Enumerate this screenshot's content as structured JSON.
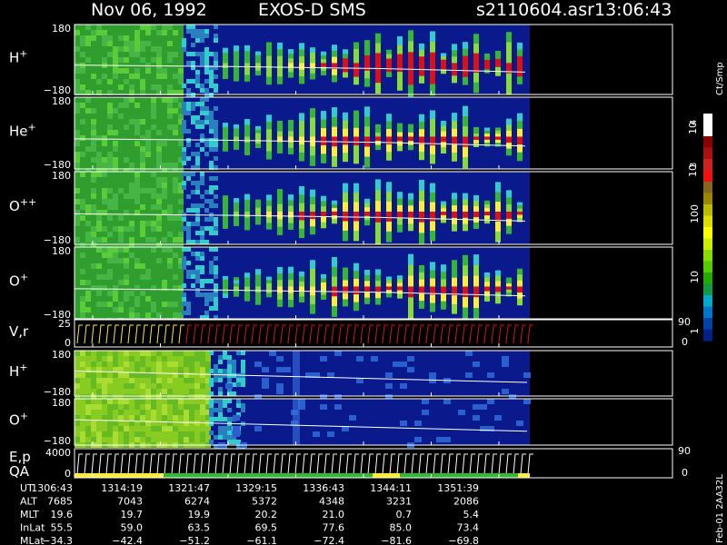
{
  "header": {
    "date": "Nov 06, 1992",
    "mission": "EXOS-D SMS",
    "file": "s2110604.asr",
    "time": "13:06:43"
  },
  "panels": [
    {
      "id": "Hp",
      "label": "H",
      "sup": "+",
      "ytop": "180",
      "ybot": "−180"
    },
    {
      "id": "Hep",
      "label": "He",
      "sup": "+",
      "ytop": "180",
      "ybot": "−180"
    },
    {
      "id": "Opp",
      "label": "O",
      "sup": "++",
      "ytop": "180",
      "ybot": "−180"
    },
    {
      "id": "Op",
      "label": "O",
      "sup": "+",
      "ytop": "180",
      "ybot": "−180"
    },
    {
      "id": "Vr",
      "label": "V,r",
      "sup": "",
      "ytop": "25",
      "ybot": "0",
      "rtop": "90",
      "rbot": "0"
    },
    {
      "id": "Hp2",
      "label": "H",
      "sup": "+",
      "ytop": "180",
      "ybot": "−180"
    },
    {
      "id": "Op2",
      "label": "O",
      "sup": "+",
      "ytop": "180",
      "ybot": "−180"
    },
    {
      "id": "Ep",
      "label": "E,p",
      "sup": "",
      "label2": "QA",
      "ytop": "4000",
      "ybot": "0",
      "rtop": "90",
      "rbot": "0"
    }
  ],
  "colorbar": {
    "title": "Ct/Smp",
    "labels": [
      "10",
      "4",
      "10",
      "3",
      "100",
      "10",
      "1"
    ]
  },
  "footer": {
    "side_text": "Feb-01 2AA32L",
    "rows": [
      {
        "name": "UT",
        "values": [
          "1306:43",
          "1314:19",
          "1321:47",
          "1329:15",
          "1336:43",
          "1344:11",
          "1351:39"
        ]
      },
      {
        "name": "ALT",
        "values": [
          "7685",
          "7043",
          "6274",
          "5372",
          "4348",
          "3231",
          "2086"
        ]
      },
      {
        "name": "MLT",
        "values": [
          "19.6",
          "19.7",
          "19.9",
          "20.2",
          "21.0",
          "0.7",
          "5.4"
        ]
      },
      {
        "name": "InLat",
        "values": [
          "55.5",
          "59.0",
          "63.5",
          "69.5",
          "77.6",
          "85.0",
          "73.4"
        ]
      },
      {
        "name": "MLat",
        "values": [
          "−34.3",
          "−42.4",
          "−51.2",
          "−61.1",
          "−72.4",
          "−81.6",
          "−69.8"
        ]
      }
    ]
  },
  "chart_data": {
    "type": "heatmap",
    "title": "Nov 06, 1992   EXOS-D SMS",
    "x_ticks": [
      "1306:43",
      "1314:19",
      "1321:47",
      "1329:15",
      "1336:43",
      "1344:11",
      "1351:39"
    ],
    "y_range_pitch": [
      -180,
      180
    ],
    "color_scale": {
      "label": "Ct/Smp",
      "log": true,
      "range": [
        1,
        10000
      ]
    },
    "series": [
      {
        "name": "H+",
        "y_range": [
          -180,
          180
        ]
      },
      {
        "name": "He+",
        "y_range": [
          -180,
          180
        ]
      },
      {
        "name": "O++",
        "y_range": [
          -180,
          180
        ]
      },
      {
        "name": "O+",
        "y_range": [
          -180,
          180
        ]
      },
      {
        "name": "V,r",
        "y_range": [
          0,
          25
        ],
        "right_range": [
          0,
          90
        ]
      },
      {
        "name": "H+",
        "y_range": [
          -180,
          180
        ]
      },
      {
        "name": "O+",
        "y_range": [
          -180,
          180
        ]
      },
      {
        "name": "E,p",
        "y_range": [
          0,
          4000
        ],
        "right_range": [
          0,
          90
        ]
      }
    ],
    "colors": {
      "background": "#0a1a8c",
      "cyan": "#33cccc",
      "green": "#33b833",
      "lightgreen": "#88dd33",
      "yellow": "#ffee33",
      "red": "#dd1111",
      "axis": "#ffffff"
    }
  }
}
